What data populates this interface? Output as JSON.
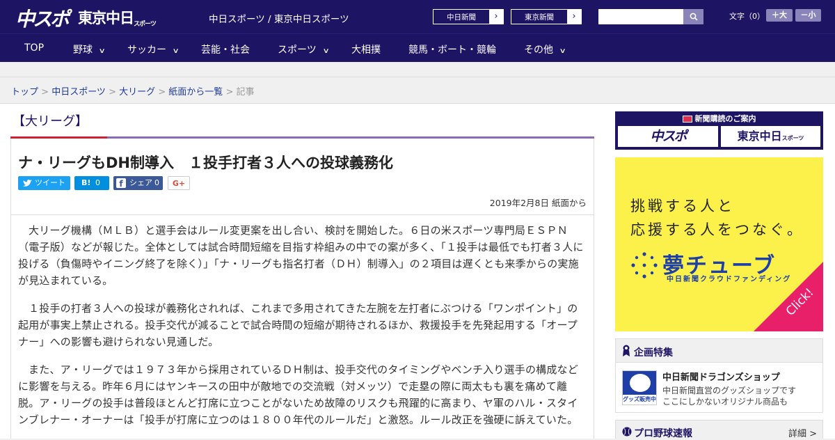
{
  "header": {
    "logo_chuspo": "中スポ",
    "logo_tokyo": "東京中日",
    "logo_tokyo_small": "スポーツ",
    "title": "中日スポーツ / 東京中日スポーツ",
    "btn_chunichi": "中日新聞",
    "btn_tokyo": "東京新聞",
    "btn_arrow": "›",
    "search_placeholder": "",
    "fontsize_label": "文字（0）",
    "fs_plus": "＋大",
    "fs_minus": "－小"
  },
  "nav": {
    "items": [
      {
        "label": "TOP",
        "has_menu": false
      },
      {
        "label": "野球",
        "has_menu": true
      },
      {
        "label": "サッカー",
        "has_menu": true
      },
      {
        "label": "芸能・社会",
        "has_menu": false
      },
      {
        "label": "スポーツ",
        "has_menu": true
      },
      {
        "label": "大相撲",
        "has_menu": false
      },
      {
        "label": "競馬・ボート・競輪",
        "has_menu": false
      },
      {
        "label": "その他",
        "has_menu": true
      }
    ],
    "chevron": "∨"
  },
  "breadcrumb": {
    "items": [
      "トップ",
      "中日スポーツ",
      "大リーグ",
      "紙面から一覧"
    ],
    "separator": " > ",
    "current": "記事"
  },
  "article": {
    "category": "【大リーグ】",
    "headline": "ナ・リーグもDH制導入　１投手打者３人への投球義務化",
    "share": {
      "tweet": "ツイート",
      "hatena": "B!",
      "hatena_count": "0",
      "facebook": "シェア",
      "facebook_count": "0",
      "gplus": "G+"
    },
    "date": "2019年2月8日 紙面から",
    "paragraphs": [
      "大リーグ機構（ＭＬＢ）と選手会はルール変更案を出し合い、検討を開始した。６日の米スポーツ専門局ＥＳＰＮ（電子版）などが報じた。全体としては試合時間短縮を目指す枠組みの中での案が多く、「１投手は最低でも打者３人に投げる（負傷時やイニング終了を除く）」「ナ・リーグも指名打者（ＤＨ）制導入」の２項目は遅くとも来季からの実施が見込まれている。",
      "１投手の打者３人への投球が義務化されれば、これまで多用されてきた左腕を左打者にぶつける「ワンポイント」の起用が事実上禁止される。投手交代が減ることで試合時間の短縮が期待されるほか、救援投手を先発起用する「オープナー」への影響も避けられない見通しだ。",
      "また、ア・リーグでは１９７３年から採用されているＤＨ制は、投手交代のタイミングやベンチ入り選手の構成などに影響を与える。昨年６月にはヤンキースの田中が敵地での交流戦（対メッツ）で走塁の際に両太もも裏を痛めて離脱。ア・リーグの投手は普段ほとんど打席に立つことがないため故障のリスクも飛躍的に高まり、ヤ軍のハル・スタインブレナー・オーナーは「投手が打席に立つのは１８００年代のルールだ」と激怒。ルール改正を強硬に訴えていた。"
    ]
  },
  "sidebar": {
    "subscribe": {
      "title": "新聞購読のご案内",
      "chuspo": "中スポ",
      "tokyo": "東京中日",
      "tokyo_small": "スポーツ"
    },
    "yume": {
      "line1": "挑戦する人と",
      "line2": "応援する人をつなぐ。",
      "logo": "夢チューブ",
      "sub": "中日新聞クラウドファンディング",
      "click": "Click!"
    },
    "special": {
      "title": "企画特集",
      "item_title": "中日新聞ドラゴンズショップ",
      "item_desc1": "中日新聞直営のグッズショップです",
      "item_desc2": "ここにしかないオリジナル商品も",
      "thumb_label": "グッズ販売中"
    },
    "baseball": {
      "title": "プロ野球速報",
      "detail": "詳細 >"
    }
  },
  "colors": {
    "brand_navy": "#1e1464",
    "accent_red": "#cc2233",
    "accent_purple": "#8a6bb0",
    "link": "#1e3a99",
    "twitter": "#1da1f2",
    "hatena": "#008fde",
    "facebook": "#3b5998",
    "gplus": "#dd4b39"
  }
}
